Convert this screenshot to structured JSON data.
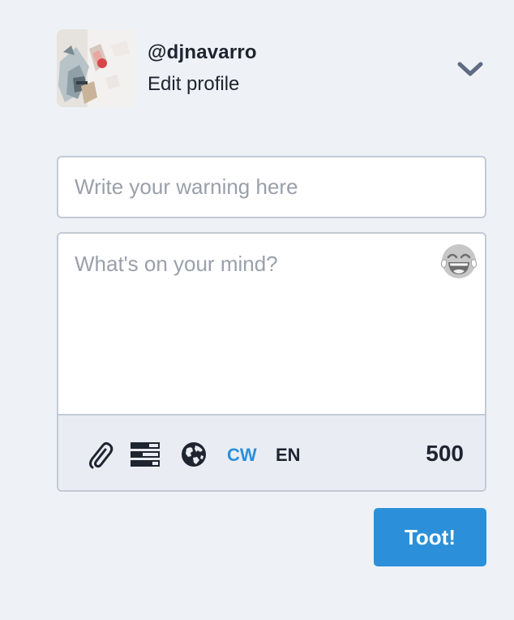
{
  "profile": {
    "handle": "@djnavarro",
    "edit_label": "Edit profile"
  },
  "icons": {
    "avatar": "avatar-image",
    "dropdown": "chevron-down-icon",
    "emoji": "laughing-emoji-icon",
    "attach": "paperclip-icon",
    "poll": "poll-icon",
    "visibility": "globe-icon"
  },
  "compose": {
    "warning_placeholder": "Write your warning here",
    "text_placeholder": "What's on your mind?",
    "cw_label": "CW",
    "language": "EN",
    "char_count": "500",
    "submit_label": "Toot!"
  },
  "colors": {
    "accent": "#2b90d9",
    "background": "#eef2f6",
    "text": "#1e2430",
    "placeholder": "#9aa0aa"
  }
}
